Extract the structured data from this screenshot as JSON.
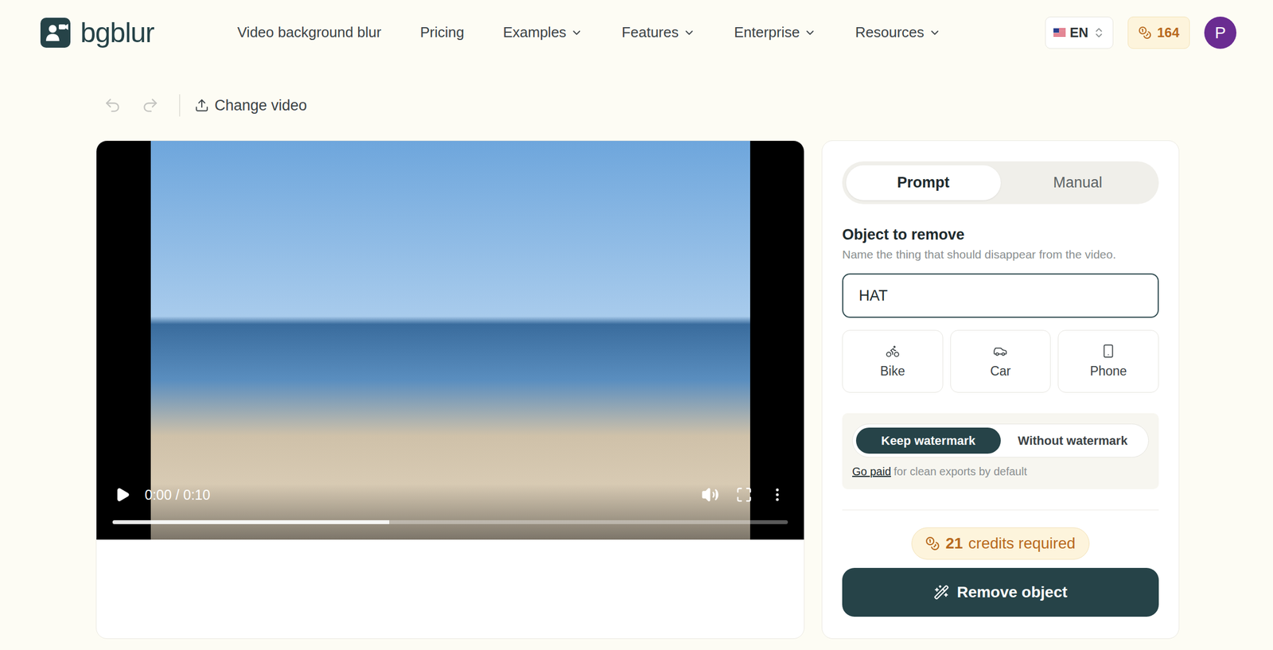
{
  "header": {
    "logo": "bgblur",
    "nav": [
      {
        "label": "Video background blur",
        "dropdown": false
      },
      {
        "label": "Pricing",
        "dropdown": false
      },
      {
        "label": "Examples",
        "dropdown": true
      },
      {
        "label": "Features",
        "dropdown": true
      },
      {
        "label": "Enterprise",
        "dropdown": true
      },
      {
        "label": "Resources",
        "dropdown": true
      }
    ],
    "language": "EN",
    "credits": "164",
    "avatar": "P"
  },
  "toolbar": {
    "undo_disabled": true,
    "redo_disabled": true,
    "change_video": "Change video"
  },
  "player": {
    "time": "0:00 / 0:10",
    "playing": false,
    "level": 0.41
  },
  "panel": {
    "modes": [
      {
        "label": "Prompt",
        "selected": true
      },
      {
        "label": "Manual",
        "selected": false
      }
    ],
    "field": {
      "label": "Object to remove",
      "hint": "Name the thing that should disappear from the video.",
      "value": "HAT"
    },
    "presets": [
      {
        "label": "Bike",
        "kind": "bike"
      },
      {
        "label": "Car",
        "kind": "car"
      },
      {
        "label": "Phone",
        "kind": "phone"
      }
    ],
    "watermark": {
      "options": [
        {
          "label": "Keep watermark",
          "selected": true
        },
        {
          "label": "Without watermark",
          "selected": false
        }
      ],
      "link": "Go paid",
      "note": "for clean exports by default"
    },
    "cost": {
      "amount": "21",
      "label": "credits required"
    },
    "action": "Remove object"
  }
}
